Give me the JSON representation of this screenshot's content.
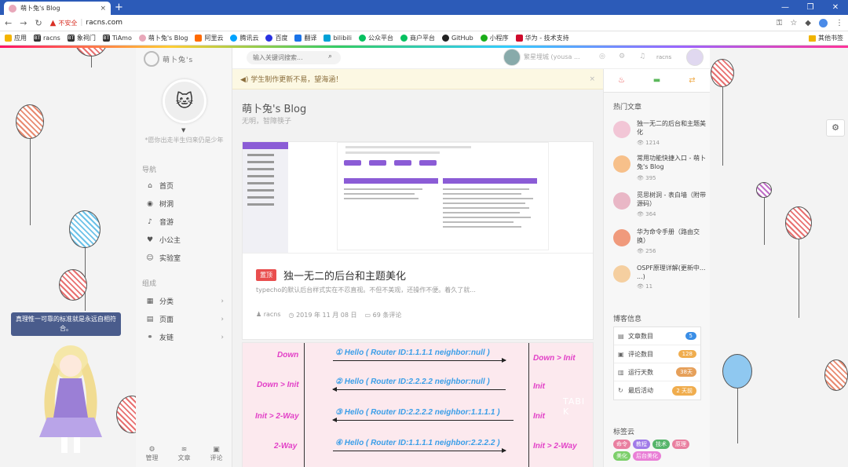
{
  "browser": {
    "tab_title": "萌卜兔's Blog",
    "tab_close": "×",
    "new_tab": "+",
    "insecure_label": "不安全",
    "separator": "|",
    "url": "racns.com",
    "window_controls": [
      "—",
      "❐",
      "✕"
    ],
    "bookmarks": [
      {
        "label": "应用",
        "color": "#f4b400"
      },
      {
        "label": "racns",
        "color": "#333333",
        "mark": "BT"
      },
      {
        "label": "象祠门",
        "color": "#333333",
        "mark": "BT"
      },
      {
        "label": "TiAmo",
        "color": "#333333",
        "mark": "BT"
      },
      {
        "label": "萌卜兔's Blog",
        "color": "#e8a7b9"
      },
      {
        "label": "阿里云",
        "color": "#ff6a00"
      },
      {
        "label": "腾讯云",
        "color": "#00a3ff"
      },
      {
        "label": "百度",
        "color": "#2932e1"
      },
      {
        "label": "翻译",
        "color": "#1a73e8"
      },
      {
        "label": "bilibili",
        "color": "#00a1d6"
      },
      {
        "label": "公众平台",
        "color": "#07c160"
      },
      {
        "label": "商户平台",
        "color": "#07c160"
      },
      {
        "label": "GitHub",
        "color": "#222222"
      },
      {
        "label": "小程序",
        "color": "#1aad19"
      },
      {
        "label": "华为 - 技术支持",
        "color": "#cf0a2c"
      }
    ],
    "other_bookmarks": "其他书签"
  },
  "site": {
    "logo_text": "萌卜兔's",
    "motto": "*愿你出走半生归来仍是少年",
    "nav_section": "导航",
    "nav": [
      {
        "label": "首页",
        "icon": "home-icon",
        "glyph": "⌂"
      },
      {
        "label": "树洞",
        "icon": "bulb-icon",
        "glyph": "◉"
      },
      {
        "label": "音游",
        "icon": "headphones-icon",
        "glyph": "♪"
      },
      {
        "label": "小公主",
        "icon": "heart-icon",
        "glyph": "♥"
      },
      {
        "label": "实验室",
        "icon": "smile-icon",
        "glyph": "☺"
      }
    ],
    "group_section": "组成",
    "groups": [
      {
        "label": "分类",
        "icon": "grid-icon",
        "glyph": "▦"
      },
      {
        "label": "页面",
        "icon": "file-icon",
        "glyph": "▤"
      },
      {
        "label": "友链",
        "icon": "link-icon",
        "glyph": "⚭"
      }
    ],
    "footer": [
      {
        "label": "管理",
        "icon": "users-icon",
        "glyph": "⚙"
      },
      {
        "label": "文章",
        "icon": "rss-icon",
        "glyph": "≋"
      },
      {
        "label": "评论",
        "icon": "comment-icon",
        "glyph": "▣"
      }
    ]
  },
  "header": {
    "search_placeholder": "输入关键词搜索...",
    "user_name": "繁星埋城 (yousa ...",
    "account_label": "racns"
  },
  "notice": {
    "text": "◀) 学生制作更新不易，望海涵！",
    "close": "×"
  },
  "main": {
    "blog_title": "萌卜兔's Blog",
    "blog_subtitle": "无明，智障筷子",
    "post": {
      "badge": "置顶",
      "title": "独一无二的后台和主题美化",
      "excerpt": "typecho的默认后台样式实在不忍直视。不但不美观，还操作不便。着久了就...",
      "author": "racns",
      "date": "2019 年 11 月 08 日",
      "comments": "69 条评论"
    },
    "diagram": {
      "left_labels": [
        "Down",
        "Down > Init",
        "Init > 2-Way",
        "2-Way"
      ],
      "right_labels": [
        "Down > Init",
        "Init",
        "Init",
        "Init > 2-Way"
      ],
      "messages": [
        "① Hello ( Router ID:1.1.1.1    neighbor:null )",
        "② Hello ( Router ID:2.2.2.2    neighbor:null )",
        "③ Hello ( Router ID:2.2.2.2    neighbor:1.1.1.1 )",
        "④ Hello ( Router ID:1.1.1.1    neighbor:2.2.2.2 )"
      ],
      "watermark": "TABI K"
    }
  },
  "right": {
    "hot_title": "热门文章",
    "hot": [
      {
        "title": "独一无二的后台和主题美化",
        "views": "👁 1214",
        "color": "#f2c6d6"
      },
      {
        "title": "常用功能快捷入口 - 萌卜兔's Blog",
        "views": "👁 395",
        "color": "#f7c08a"
      },
      {
        "title": "觅思树洞 - 表白墙（附带源码）",
        "views": "👁 364",
        "color": "#e9b7c6"
      },
      {
        "title": "华为命令手册（路由交换）",
        "views": "👁 256",
        "color": "#f09a7c"
      },
      {
        "title": "OSPF原理详解(更新中... ...)",
        "views": "👁 11",
        "color": "#f5cfa0"
      }
    ],
    "info_title": "博客信息",
    "info": [
      {
        "label": "文章数目",
        "value": "5",
        "color": "#3a8ee6",
        "glyph": "▤"
      },
      {
        "label": "评论数目",
        "value": "128",
        "color": "#f0ad4e",
        "glyph": "▣"
      },
      {
        "label": "运行天数",
        "value": "38天",
        "color": "#e6a05a",
        "glyph": "▥"
      },
      {
        "label": "最后活动",
        "value": "2 天前",
        "color": "#f0ad4e",
        "glyph": "↻"
      }
    ],
    "tags_title": "标签云",
    "tags": [
      {
        "label": "命令",
        "color": "#e97fa0"
      },
      {
        "label": "教程",
        "color": "#a07ae8"
      },
      {
        "label": "技术",
        "color": "#56b56a"
      },
      {
        "label": "原理",
        "color": "#e97fa0"
      },
      {
        "label": "美化",
        "color": "#7ccf6a"
      },
      {
        "label": "后台美化",
        "color": "#e97fd6"
      }
    ]
  },
  "widgets": {
    "tooltip": "真理惟一可靠的标准就是永远自相符合。"
  }
}
